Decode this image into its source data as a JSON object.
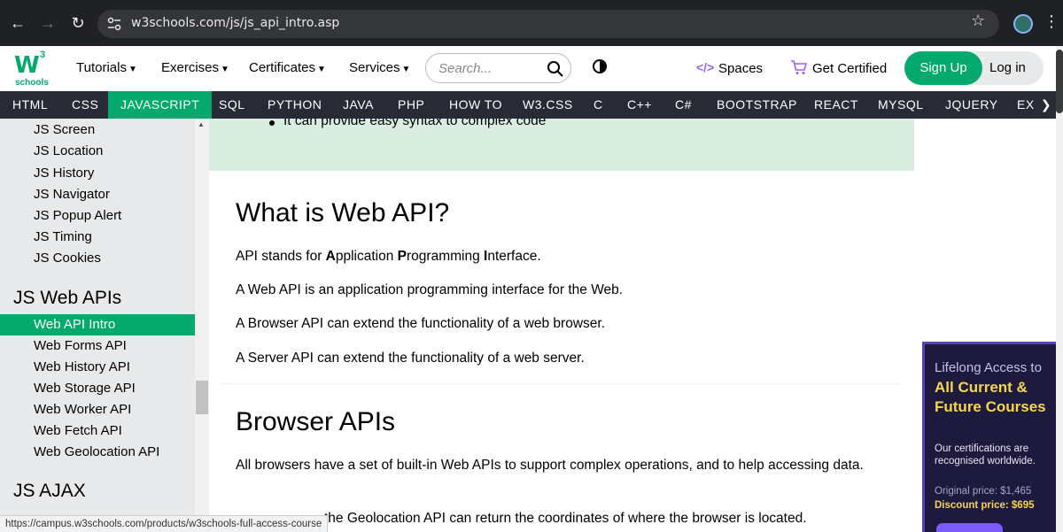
{
  "browser": {
    "url": "w3schools.com/js/js_api_intro.asp",
    "back_icon": "←",
    "forward_icon": "→",
    "reload_icon": "↻",
    "star_icon": "☆",
    "menu_icon": "⋮"
  },
  "topbar": {
    "logo": {
      "main": "W",
      "sup": "3",
      "sub": "schools"
    },
    "nav": [
      "Tutorials",
      "Exercises",
      "Certificates",
      "Services"
    ],
    "search_placeholder": "Search...",
    "spaces_icon": "</>",
    "spaces": "Spaces",
    "get_certified": "Get Certified",
    "sign_up": "Sign Up",
    "log_in": "Log in"
  },
  "darknav": {
    "items": [
      "HTML",
      "CSS",
      "JAVASCRIPT",
      "SQL",
      "PYTHON",
      "JAVA",
      "PHP",
      "HOW TO",
      "W3.CSS",
      "C",
      "C++",
      "C#",
      "BOOTSTRAP",
      "REACT",
      "MYSQL",
      "JQUERY",
      "EX"
    ],
    "active": "JAVASCRIPT"
  },
  "sidebar": {
    "items_top": [
      "JS Screen",
      "JS Location",
      "JS History",
      "JS Navigator",
      "JS Popup Alert",
      "JS Timing",
      "JS Cookies"
    ],
    "section_web_apis": "JS Web APIs",
    "items_web_apis": [
      "Web API Intro",
      "Web Forms API",
      "Web History API",
      "Web Storage API",
      "Web Worker API",
      "Web Fetch API",
      "Web Geolocation API"
    ],
    "active": "Web API Intro",
    "section_ajax": "JS AJAX"
  },
  "main": {
    "note_item": "It can provide easy syntax to complex code",
    "h_what": "What is Web API?",
    "p1_parts": [
      "API stands for ",
      "A",
      "pplication ",
      "P",
      "rogramming ",
      "I",
      "nterface."
    ],
    "p2": "A Web API is an application programming interface for the Web.",
    "p3": "A Browser API can extend the functionality of a web browser.",
    "p4": "A Server API can extend the functionality of a web server.",
    "h_browser": "Browser APIs",
    "p5": "All browsers have a set of built-in Web APIs to support complex operations, and to help accessing data.",
    "p6_visible": "the Geolocation API can return the coordinates of where the browser is located."
  },
  "ad": {
    "line1": "Lifelong Access to",
    "line2": "All Current & Future Courses",
    "line3": "Our certifications are recognised worldwide.",
    "original_price": "Original price: $1,465",
    "discount_price": "Discount price: $695"
  },
  "status_url": "https://campus.w3schools.com/products/w3schools-full-access-course",
  "colors": {
    "brand_green": "#04aa6d",
    "dark_nav": "#282a35",
    "sidebar_bg": "#e7e9eb",
    "note_bg": "#d9eee1",
    "ad_bg": "#1d1a3d",
    "ad_highlight": "#f6d64b",
    "spaces_purple": "#9763f6"
  }
}
